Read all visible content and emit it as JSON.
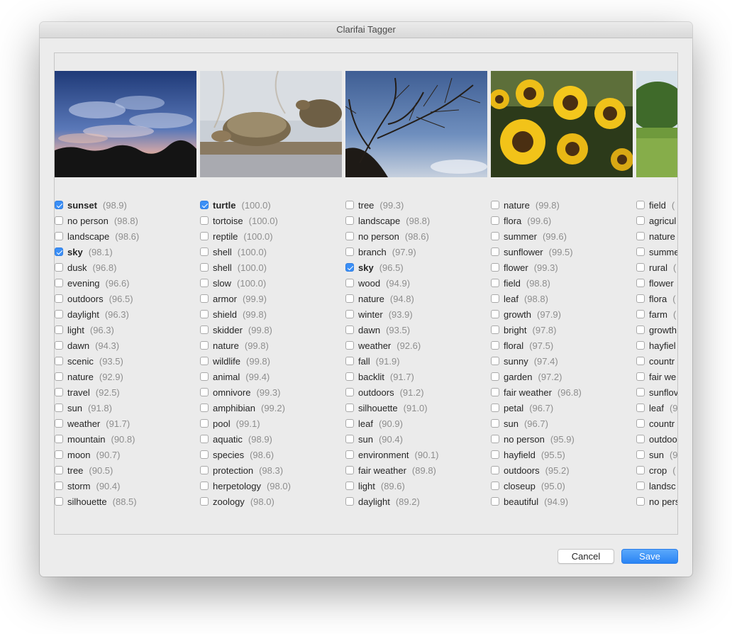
{
  "window": {
    "title": "Clarifai Tagger"
  },
  "buttons": {
    "cancel": "Cancel",
    "save": "Save"
  },
  "columns": [
    {
      "image": "night-sky-clouds",
      "tags": [
        {
          "name": "sunset",
          "score": "(98.9)",
          "checked": true
        },
        {
          "name": "no person",
          "score": "(98.8)",
          "checked": false
        },
        {
          "name": "landscape",
          "score": "(98.6)",
          "checked": false
        },
        {
          "name": "sky",
          "score": "(98.1)",
          "checked": true
        },
        {
          "name": "dusk",
          "score": "(96.8)",
          "checked": false
        },
        {
          "name": "evening",
          "score": "(96.6)",
          "checked": false
        },
        {
          "name": "outdoors",
          "score": "(96.5)",
          "checked": false
        },
        {
          "name": "daylight",
          "score": "(96.3)",
          "checked": false
        },
        {
          "name": "light",
          "score": "(96.3)",
          "checked": false
        },
        {
          "name": "dawn",
          "score": "(94.3)",
          "checked": false
        },
        {
          "name": "scenic",
          "score": "(93.5)",
          "checked": false
        },
        {
          "name": "nature",
          "score": "(92.9)",
          "checked": false
        },
        {
          "name": "travel",
          "score": "(92.5)",
          "checked": false
        },
        {
          "name": "sun",
          "score": "(91.8)",
          "checked": false
        },
        {
          "name": "weather",
          "score": "(91.7)",
          "checked": false
        },
        {
          "name": "mountain",
          "score": "(90.8)",
          "checked": false
        },
        {
          "name": "moon",
          "score": "(90.7)",
          "checked": false
        },
        {
          "name": "tree",
          "score": "(90.5)",
          "checked": false
        },
        {
          "name": "storm",
          "score": "(90.4)",
          "checked": false
        },
        {
          "name": "silhouette",
          "score": "(88.5)",
          "checked": false
        }
      ]
    },
    {
      "image": "turtles-on-log",
      "tags": [
        {
          "name": "turtle",
          "score": "(100.0)",
          "checked": true
        },
        {
          "name": "tortoise",
          "score": "(100.0)",
          "checked": false
        },
        {
          "name": "reptile",
          "score": "(100.0)",
          "checked": false
        },
        {
          "name": "shell",
          "score": "(100.0)",
          "checked": false
        },
        {
          "name": "shell",
          "score": "(100.0)",
          "checked": false
        },
        {
          "name": "slow",
          "score": "(100.0)",
          "checked": false
        },
        {
          "name": "armor",
          "score": "(99.9)",
          "checked": false
        },
        {
          "name": "shield",
          "score": "(99.8)",
          "checked": false
        },
        {
          "name": "skidder",
          "score": "(99.8)",
          "checked": false
        },
        {
          "name": "nature",
          "score": "(99.8)",
          "checked": false
        },
        {
          "name": "wildlife",
          "score": "(99.8)",
          "checked": false
        },
        {
          "name": "animal",
          "score": "(99.4)",
          "checked": false
        },
        {
          "name": "omnivore",
          "score": "(99.3)",
          "checked": false
        },
        {
          "name": "amphibian",
          "score": "(99.2)",
          "checked": false
        },
        {
          "name": "pool",
          "score": "(99.1)",
          "checked": false
        },
        {
          "name": "aquatic",
          "score": "(98.9)",
          "checked": false
        },
        {
          "name": "species",
          "score": "(98.6)",
          "checked": false
        },
        {
          "name": "protection",
          "score": "(98.3)",
          "checked": false
        },
        {
          "name": "herpetology",
          "score": "(98.0)",
          "checked": false
        },
        {
          "name": "zoology",
          "score": "(98.0)",
          "checked": false
        }
      ]
    },
    {
      "image": "bare-tree-branches",
      "tags": [
        {
          "name": "tree",
          "score": "(99.3)",
          "checked": false
        },
        {
          "name": "landscape",
          "score": "(98.8)",
          "checked": false
        },
        {
          "name": "no person",
          "score": "(98.6)",
          "checked": false
        },
        {
          "name": "branch",
          "score": "(97.9)",
          "checked": false
        },
        {
          "name": "sky",
          "score": "(96.5)",
          "checked": true
        },
        {
          "name": "wood",
          "score": "(94.9)",
          "checked": false
        },
        {
          "name": "nature",
          "score": "(94.8)",
          "checked": false
        },
        {
          "name": "winter",
          "score": "(93.9)",
          "checked": false
        },
        {
          "name": "dawn",
          "score": "(93.5)",
          "checked": false
        },
        {
          "name": "weather",
          "score": "(92.6)",
          "checked": false
        },
        {
          "name": "fall",
          "score": "(91.9)",
          "checked": false
        },
        {
          "name": "backlit",
          "score": "(91.7)",
          "checked": false
        },
        {
          "name": "outdoors",
          "score": "(91.2)",
          "checked": false
        },
        {
          "name": "silhouette",
          "score": "(91.0)",
          "checked": false
        },
        {
          "name": "leaf",
          "score": "(90.9)",
          "checked": false
        },
        {
          "name": "sun",
          "score": "(90.4)",
          "checked": false
        },
        {
          "name": "environment",
          "score": "(90.1)",
          "checked": false
        },
        {
          "name": "fair weather",
          "score": "(89.8)",
          "checked": false
        },
        {
          "name": "light",
          "score": "(89.6)",
          "checked": false
        },
        {
          "name": "daylight",
          "score": "(89.2)",
          "checked": false
        }
      ]
    },
    {
      "image": "sunflowers",
      "tags": [
        {
          "name": "nature",
          "score": "(99.8)",
          "checked": false
        },
        {
          "name": "flora",
          "score": "(99.6)",
          "checked": false
        },
        {
          "name": "summer",
          "score": "(99.6)",
          "checked": false
        },
        {
          "name": "sunflower",
          "score": "(99.5)",
          "checked": false
        },
        {
          "name": "flower",
          "score": "(99.3)",
          "checked": false
        },
        {
          "name": "field",
          "score": "(98.8)",
          "checked": false
        },
        {
          "name": "leaf",
          "score": "(98.8)",
          "checked": false
        },
        {
          "name": "growth",
          "score": "(97.9)",
          "checked": false
        },
        {
          "name": "bright",
          "score": "(97.8)",
          "checked": false
        },
        {
          "name": "floral",
          "score": "(97.5)",
          "checked": false
        },
        {
          "name": "sunny",
          "score": "(97.4)",
          "checked": false
        },
        {
          "name": "garden",
          "score": "(97.2)",
          "checked": false
        },
        {
          "name": "fair weather",
          "score": "(96.8)",
          "checked": false
        },
        {
          "name": "petal",
          "score": "(96.7)",
          "checked": false
        },
        {
          "name": "sun",
          "score": "(96.7)",
          "checked": false
        },
        {
          "name": "no person",
          "score": "(95.9)",
          "checked": false
        },
        {
          "name": "hayfield",
          "score": "(95.5)",
          "checked": false
        },
        {
          "name": "outdoors",
          "score": "(95.2)",
          "checked": false
        },
        {
          "name": "closeup",
          "score": "(95.0)",
          "checked": false
        },
        {
          "name": "beautiful",
          "score": "(94.9)",
          "checked": false
        }
      ]
    },
    {
      "image": "green-field",
      "tags": [
        {
          "name": "field",
          "score": "(",
          "checked": false
        },
        {
          "name": "agricul",
          "score": "",
          "checked": false
        },
        {
          "name": "nature",
          "score": "",
          "checked": false
        },
        {
          "name": "summe",
          "score": "",
          "checked": false
        },
        {
          "name": "rural",
          "score": "(",
          "checked": false
        },
        {
          "name": "flower",
          "score": "",
          "checked": false
        },
        {
          "name": "flora",
          "score": "(",
          "checked": false
        },
        {
          "name": "farm",
          "score": "(",
          "checked": false
        },
        {
          "name": "growth",
          "score": "",
          "checked": false
        },
        {
          "name": "hayfiel",
          "score": "",
          "checked": false
        },
        {
          "name": "countr",
          "score": "",
          "checked": false
        },
        {
          "name": "fair we",
          "score": "",
          "checked": false
        },
        {
          "name": "sunflov",
          "score": "",
          "checked": false
        },
        {
          "name": "leaf",
          "score": "(9",
          "checked": false
        },
        {
          "name": "countr",
          "score": "",
          "checked": false
        },
        {
          "name": "outdoo",
          "score": "",
          "checked": false
        },
        {
          "name": "sun",
          "score": "(9",
          "checked": false
        },
        {
          "name": "crop",
          "score": "(",
          "checked": false
        },
        {
          "name": "landsc",
          "score": "",
          "checked": false
        },
        {
          "name": "no pers",
          "score": "",
          "checked": false
        }
      ]
    }
  ]
}
